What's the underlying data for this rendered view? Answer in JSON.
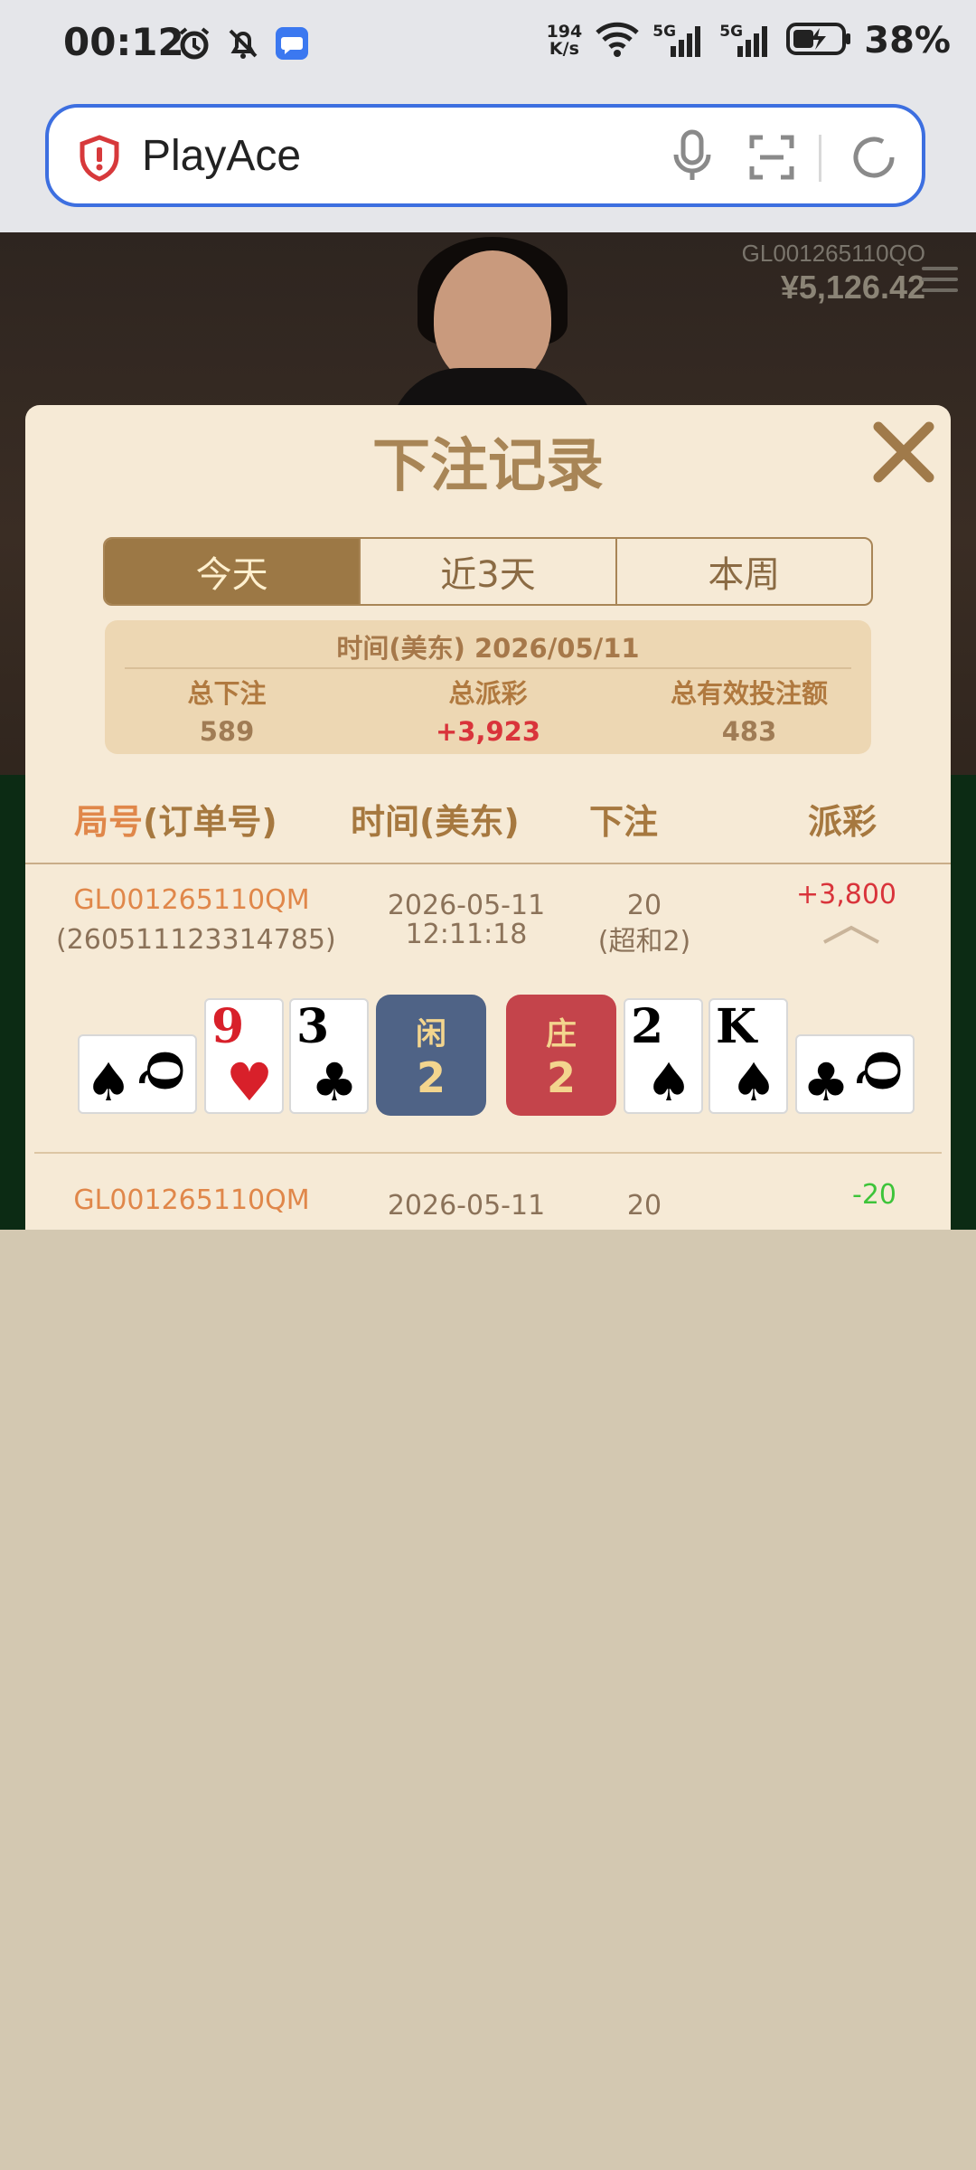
{
  "status_bar": {
    "time": "00:12",
    "net_speed_top": "194",
    "net_speed_bottom": "K/s",
    "signal1_label": "5G",
    "signal2_label": "5G",
    "battery": "38%"
  },
  "browser": {
    "url_text": "PlayAce"
  },
  "game": {
    "account_id": "GL001265110QO",
    "balance": "¥5,126.42"
  },
  "modal": {
    "title": "下注记录",
    "tabs": [
      {
        "label": "今天",
        "active": true
      },
      {
        "label": "近3天",
        "active": false
      },
      {
        "label": "本周",
        "active": false
      }
    ],
    "summary": {
      "time_line": "时间(美东) 2026/05/11",
      "total_bet_label": "总下注",
      "total_bet_value": "589",
      "total_payout_label": "总派彩",
      "total_payout_value": "+3,923",
      "total_valid_label": "总有效投注额",
      "total_valid_value": "483"
    },
    "table": {
      "col_round_a": "局号",
      "col_round_b": "(订单号)",
      "col_time": "时间(美东)",
      "col_bet": "下注",
      "col_payout": "派彩"
    },
    "rows": [
      {
        "round_id": "GL001265110QM",
        "order_no": "(260511123314785)",
        "date": "2026-05-11",
        "time": "12:11:18",
        "bet_amount": "20",
        "bet_type": "(超和2)",
        "payout": "+3,800",
        "player_cards": [
          {
            "rank": "Q",
            "suit": "♠",
            "color": "black",
            "rotated": true
          },
          {
            "rank": "9",
            "suit": "♥",
            "color": "red"
          },
          {
            "rank": "3",
            "suit": "♣",
            "color": "black"
          }
        ],
        "player_label": "闲",
        "player_total": "2",
        "banker_label": "庄",
        "banker_total": "2",
        "banker_cards": [
          {
            "rank": "2",
            "suit": "♠",
            "color": "black"
          },
          {
            "rank": "K",
            "suit": "♠",
            "color": "black"
          },
          {
            "rank": "Q",
            "suit": "♣",
            "color": "black",
            "rotated": true
          }
        ]
      },
      {
        "round_id": "GL001265110QM",
        "date": "2026-05-11",
        "bet_amount": "20",
        "payout": "-20"
      }
    ]
  },
  "colors": {
    "modal_bg": "#f6ead6",
    "accent_gold": "#9c7845",
    "orange": "#e0874a",
    "payout_red": "#d9343b",
    "payout_green": "#3ec43a",
    "player_blue": "#4f6386",
    "banker_red": "#c4444b",
    "page_bg": "#d3c8b1"
  }
}
